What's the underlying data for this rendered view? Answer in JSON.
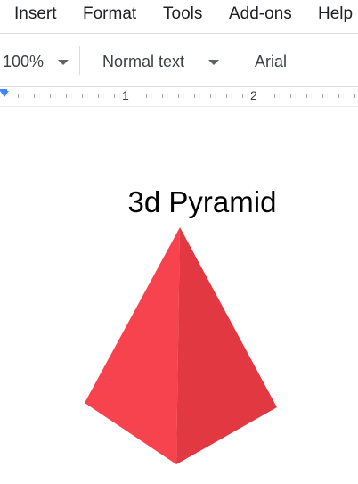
{
  "menu": {
    "insert": "Insert",
    "format": "Format",
    "tools": "Tools",
    "addons": "Add-ons",
    "help": "Help"
  },
  "toolbar": {
    "zoom": "100%",
    "text_style": "Normal text",
    "font": "Arial"
  },
  "ruler": {
    "marks": [
      "1",
      "2"
    ]
  },
  "document": {
    "title": "3d Pyramid"
  },
  "colors": {
    "pyramid_left_face": "#f7434d",
    "pyramid_right_face": "#e23841",
    "ruler_indent": "#4285f4"
  },
  "icons": {
    "zoom_dropdown": "caret-down-icon",
    "style_dropdown": "caret-down-icon"
  }
}
